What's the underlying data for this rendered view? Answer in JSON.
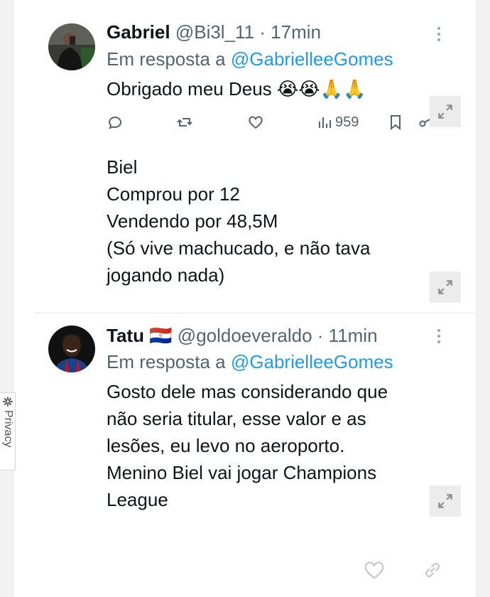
{
  "tweets": [
    {
      "name": "Gabriel",
      "flag": "",
      "handle": "@Bi3l_11",
      "time": "· 17min",
      "reply_prefix": "Em resposta a",
      "reply_mention": "@GabrielleeGomes",
      "text": "Obrigado meu Deus 😭😭🙏🙏",
      "views": "959"
    },
    {
      "name": "Tatu",
      "flag": "🇵🇾",
      "handle": "@goldoeveraldo",
      "time": "· 11min",
      "reply_prefix": "Em resposta a",
      "reply_mention": "@GabrielleeGomes",
      "text": "Gosto dele mas considerando que\nnão seria titular, esse valor e as\nlesões, eu levo no aeroporto.\nMenino Biel vai jogar Champions\nLeague"
    }
  ],
  "quoted_text": "Biel\nComprou por 12\nVendendo por 48,5M\n(Só vive machucado, e não tava\njogando nada)",
  "privacy_label": "Privacy",
  "colors": {
    "text": "#0f1419",
    "muted": "#536471",
    "link": "#1d9bf0"
  },
  "icons": [
    "reply-icon",
    "retweet-icon",
    "like-icon",
    "views-icon",
    "bookmark-icon",
    "share-icon",
    "expand-icon",
    "more-icon",
    "link-icon",
    "gear-icon"
  ]
}
